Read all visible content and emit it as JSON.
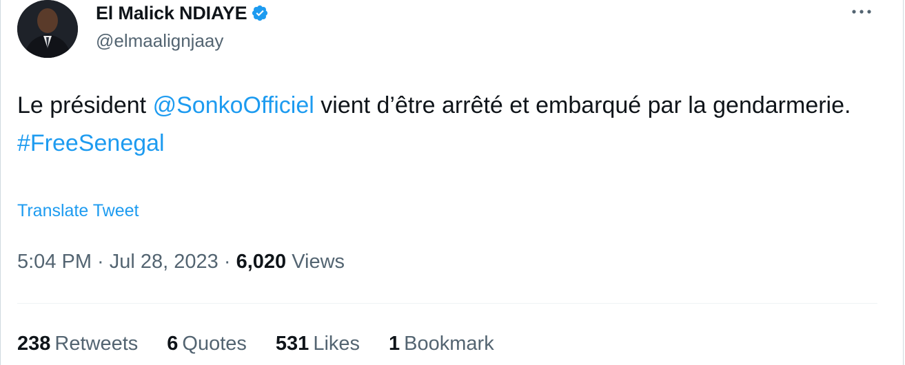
{
  "author": {
    "display_name": "El Malick NDIAYE",
    "handle": "@elmaalignjaay",
    "verified": true
  },
  "tweet": {
    "text_before": "Le président ",
    "mention": "@SonkoOfficiel",
    "text_after": " vient d’être arrêté et embarqué par la gendarmerie.",
    "hashtag": "#FreeSenegal"
  },
  "translate_label": "Translate Tweet",
  "meta": {
    "time": "5:04 PM",
    "separator": " · ",
    "date": "Jul 28, 2023",
    "views_count": "6,020",
    "views_label": "Views"
  },
  "stats": {
    "retweets_count": "238",
    "retweets_label": "Retweets",
    "quotes_count": "6",
    "quotes_label": "Quotes",
    "likes_count": "531",
    "likes_label": "Likes",
    "bookmarks_count": "1",
    "bookmarks_label": "Bookmark"
  },
  "colors": {
    "link": "#1d9bf0",
    "secondary_text": "#536471",
    "primary_text": "#0f1419",
    "verified_badge": "#1d9bf0"
  },
  "icons": {
    "verified": "verified-badge-icon",
    "more": "more-horizontal-icon"
  }
}
